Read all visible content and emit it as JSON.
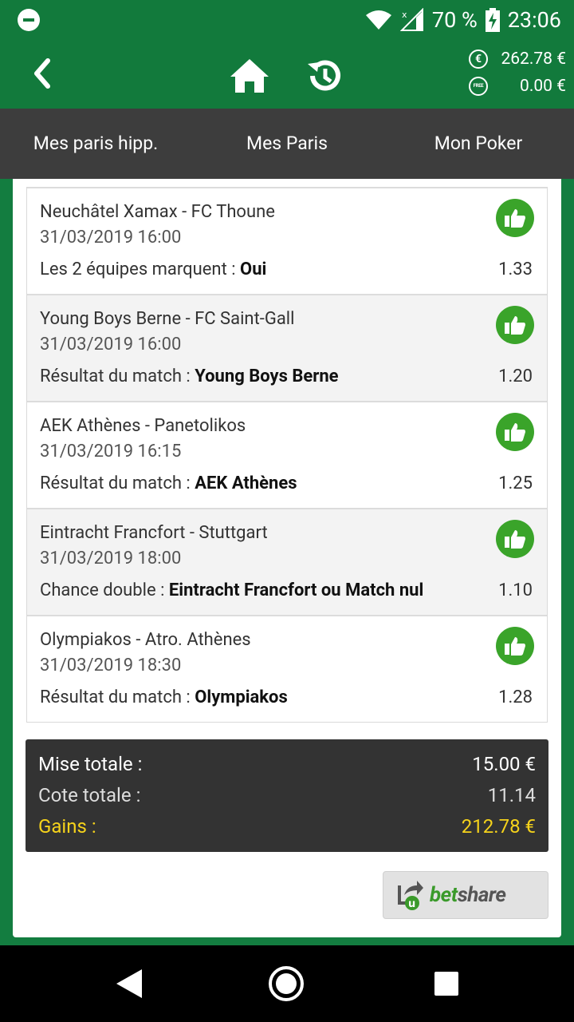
{
  "status_bar": {
    "battery": "70 %",
    "time": "23:06"
  },
  "header": {
    "balance_euro": "262.78 €",
    "balance_free": "0.00 €",
    "free_coin_label": "FREE",
    "euro_coin_label": "€"
  },
  "tabs": [
    {
      "label": "Mes paris hipp."
    },
    {
      "label": "Mes Paris"
    },
    {
      "label": "Mon Poker"
    }
  ],
  "bets": [
    {
      "match": "Neuchâtel Xamax - FC Thoune",
      "date": "31/03/2019 16:00",
      "market": "Les 2 équipes marquent : ",
      "selection": "Oui",
      "odd": "1.33"
    },
    {
      "match": "Young Boys Berne - FC Saint-Gall",
      "date": "31/03/2019 16:00",
      "market": "Résultat du match : ",
      "selection": "Young Boys Berne",
      "odd": "1.20"
    },
    {
      "match": "AEK Athènes - Panetolikos",
      "date": "31/03/2019 16:15",
      "market": "Résultat du match : ",
      "selection": "AEK Athènes",
      "odd": "1.25"
    },
    {
      "match": "Eintracht Francfort - Stuttgart",
      "date": "31/03/2019 18:00",
      "market": "Chance double : ",
      "selection": "Eintracht Francfort ou Match nul",
      "odd": "1.10"
    },
    {
      "match": "Olympiakos - Atro. Athènes",
      "date": "31/03/2019 18:30",
      "market": "Résultat du match : ",
      "selection": "Olympiakos",
      "odd": "1.28"
    }
  ],
  "summary": {
    "mise_label": "Mise totale :",
    "mise_value": "15.00 €",
    "cote_label": "Cote totale :",
    "cote_value": "11.14",
    "gains_label": "Gains :",
    "gains_value": "212.78 €"
  },
  "betshare": {
    "bet": "bet",
    "share": "share"
  },
  "colors": {
    "brand_green": "#127a3c",
    "tab_bar": "#3d3d3d",
    "thumb_green": "#3aa42a",
    "gains_yellow": "#f5d21b"
  }
}
